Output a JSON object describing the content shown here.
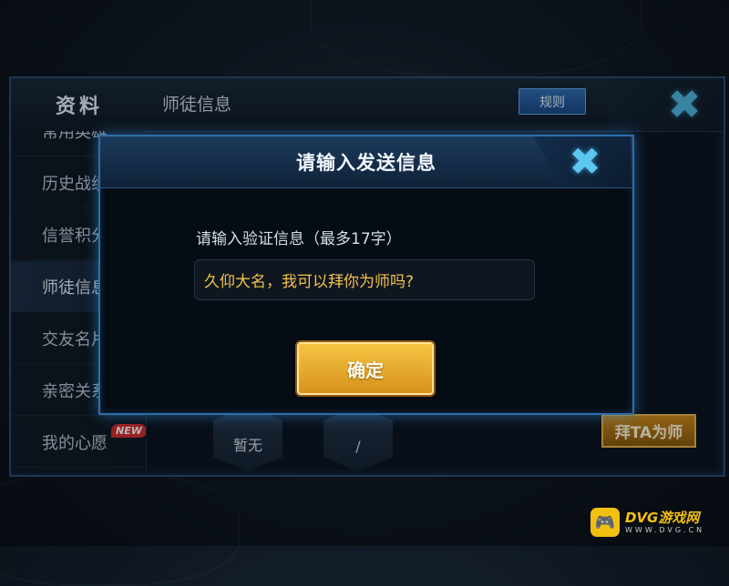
{
  "header": {
    "tab": "资料",
    "title": "师徒信息",
    "rules_label": "规则",
    "close_icon": "close-x-icon"
  },
  "sidebar": {
    "items": [
      {
        "label": "常用英雄"
      },
      {
        "label": "历史战绩"
      },
      {
        "label": "信誉积分"
      },
      {
        "label": "师徒信息"
      },
      {
        "label": "交友名片"
      },
      {
        "label": "亲密关系"
      },
      {
        "label": "我的心愿"
      }
    ],
    "new_badge": "NEW"
  },
  "content": {
    "medal_1_label": "暂无",
    "medal_2_label": "/",
    "apprentice_button": "拜TA为师"
  },
  "dialog": {
    "title": "请输入发送信息",
    "prompt": "请输入验证信息（最多17字）",
    "input_value": "久仰大名，我可以拜你为师吗?",
    "confirm_label": "确定"
  },
  "watermark": {
    "main": "DVG游戏网",
    "sub": "WWW.DVG.CN"
  },
  "colors": {
    "accent_blue": "#4fb6e2",
    "gold": "#f2c010",
    "input_text": "#f1c34a"
  }
}
